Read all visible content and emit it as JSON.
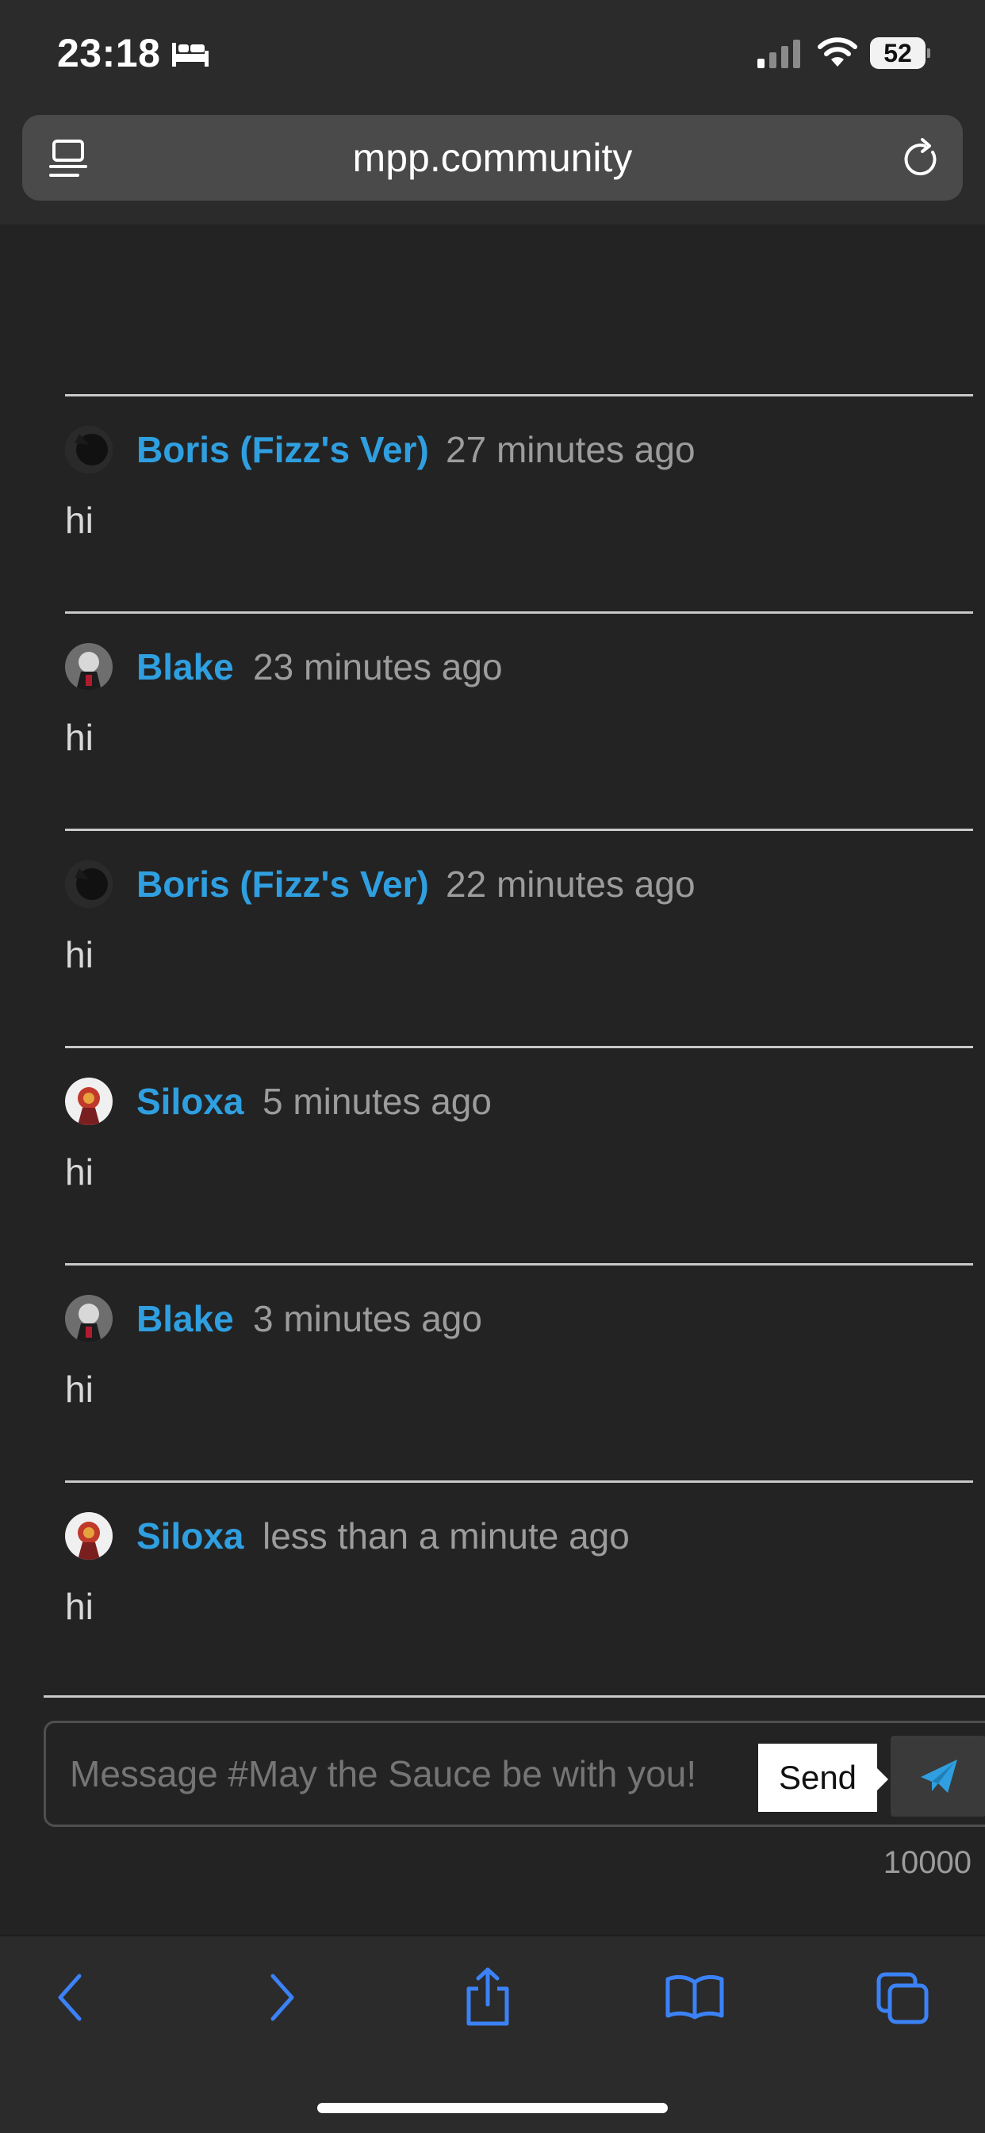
{
  "status_bar": {
    "time": "23:18",
    "battery": "52",
    "icons": [
      "bed-icon",
      "signal-icon",
      "wifi-icon",
      "battery-icon"
    ]
  },
  "browser": {
    "url": "mpp.community",
    "icons": [
      "reader-mode-icon",
      "reload-icon"
    ]
  },
  "colors": {
    "username": "#2f9fe0",
    "background": "#232323",
    "timestamp": "#9c9c9c"
  },
  "messages": [
    {
      "user": "Boris (Fizz's Ver)",
      "time": "27 minutes ago",
      "text": "hi",
      "avatar": "dark-avatar"
    },
    {
      "user": "Blake",
      "time": "23 minutes ago",
      "text": "hi",
      "avatar": "blake-avatar"
    },
    {
      "user": "Boris (Fizz's Ver)",
      "time": "22 minutes ago",
      "text": "hi",
      "avatar": "dark-avatar"
    },
    {
      "user": "Siloxa",
      "time": "5 minutes ago",
      "text": "hi",
      "avatar": "siloxa-avatar"
    },
    {
      "user": "Blake",
      "time": "3 minutes ago",
      "text": "hi",
      "avatar": "blake-avatar"
    },
    {
      "user": "Siloxa",
      "time": "less than a minute ago",
      "text": "hi",
      "avatar": "siloxa-avatar"
    }
  ],
  "composer": {
    "placeholder": "Message #May the Sauce be with you!",
    "tooltip": "Send",
    "send_icon": "paper-plane-icon",
    "char_count": "10000"
  },
  "bottom_bar": {
    "icons": [
      "back-icon",
      "forward-icon",
      "share-icon",
      "bookmarks-icon",
      "tabs-icon"
    ]
  }
}
